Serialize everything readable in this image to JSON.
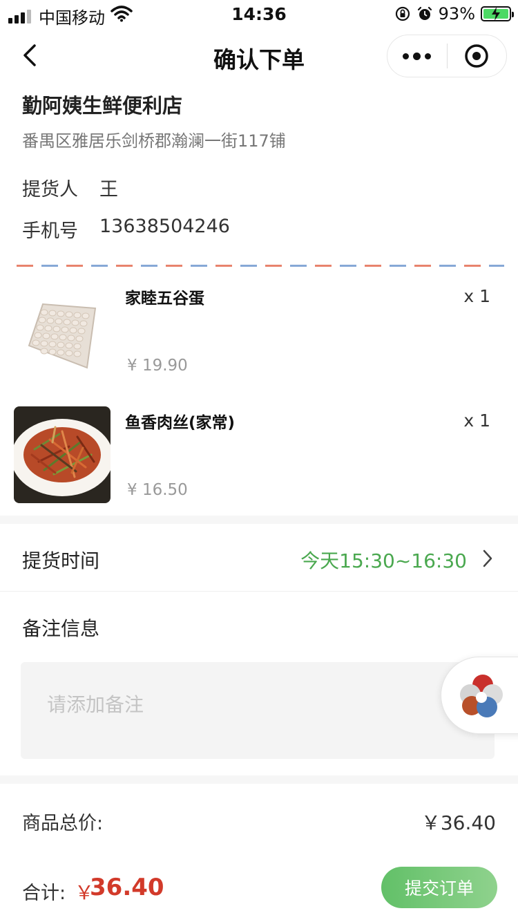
{
  "status_bar": {
    "carrier": "中国移动",
    "time": "14:36",
    "battery_percent": "93%",
    "icons": [
      "signal-icon",
      "wifi-icon",
      "rotation-lock-icon",
      "alarm-icon",
      "battery-charging-icon"
    ]
  },
  "nav": {
    "title": "确认下单",
    "icons": [
      "back-arrow-icon",
      "more-dots-icon",
      "close-target-icon"
    ]
  },
  "store": {
    "name": "勤阿姨生鲜便利店",
    "address": "番禺区雅居乐剑桥郡瀚澜一街117铺"
  },
  "pickup_person": {
    "label": "提货人",
    "value": "王"
  },
  "phone": {
    "label": "手机号",
    "value": "13638504246"
  },
  "goods": [
    {
      "name": "家睦五谷蛋",
      "price": "¥ 19.90",
      "qty": "x 1",
      "image": "egg-tray-image"
    },
    {
      "name": "鱼香肉丝(家常)",
      "price": "¥ 16.50",
      "qty": "x 1",
      "image": "shredded-pork-dish-image"
    }
  ],
  "pickup_time": {
    "label": "提货时间",
    "value": "今天15:30~16:30",
    "value_color": "#4aa84f"
  },
  "remark": {
    "label": "备注信息",
    "placeholder": "请添加备注",
    "value": ""
  },
  "goods_total": {
    "label": "商品总价:",
    "value": "￥36.40"
  },
  "footer": {
    "total_label": "合计:",
    "currency": "￥",
    "total_value": "36.40",
    "total_color": "#d23a2a",
    "submit_label": "提交订单",
    "submit_color": "#62c068"
  }
}
